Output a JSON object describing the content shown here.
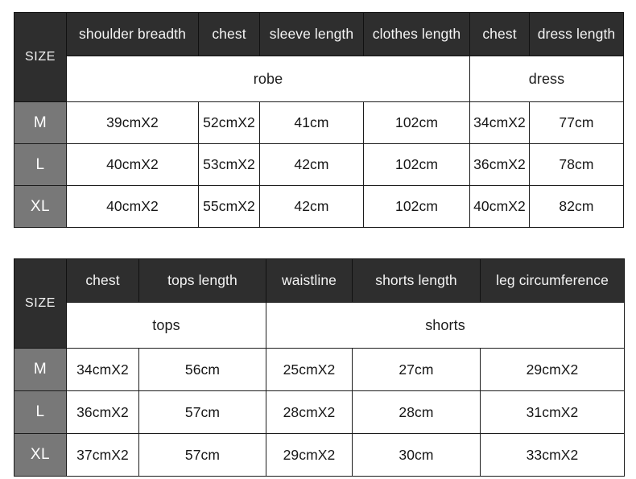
{
  "tables": [
    {
      "id": "robe-dress",
      "size_header": "SIZE",
      "columns": [
        "shoulder breadth",
        "chest",
        "sleeve length",
        "clothes length",
        "chest",
        "dress length"
      ],
      "groups": [
        {
          "label": "robe",
          "span": 4
        },
        {
          "label": "dress",
          "span": 2
        }
      ],
      "rows": [
        {
          "size": "M",
          "values": [
            "39cmX2",
            "52cmX2",
            "41cm",
            "102cm",
            "34cmX2",
            "77cm"
          ]
        },
        {
          "size": "L",
          "values": [
            "40cmX2",
            "53cmX2",
            "42cm",
            "102cm",
            "36cmX2",
            "78cm"
          ]
        },
        {
          "size": "XL",
          "values": [
            "40cmX2",
            "55cmX2",
            "42cm",
            "102cm",
            "40cmX2",
            "82cm"
          ]
        }
      ]
    },
    {
      "id": "tops-shorts",
      "size_header": "SIZE",
      "columns": [
        "chest",
        "tops length",
        "waistline",
        "shorts length",
        "leg circumference"
      ],
      "groups": [
        {
          "label": "tops",
          "span": 2
        },
        {
          "label": "shorts",
          "span": 3
        }
      ],
      "rows": [
        {
          "size": "M",
          "values": [
            "34cmX2",
            "56cm",
            "25cmX2",
            "27cm",
            "29cmX2"
          ]
        },
        {
          "size": "L",
          "values": [
            "36cmX2",
            "57cm",
            "28cmX2",
            "28cm",
            "31cmX2"
          ]
        },
        {
          "size": "XL",
          "values": [
            "37cmX2",
            "57cm",
            "29cmX2",
            "30cm",
            "33cmX2"
          ]
        }
      ]
    }
  ],
  "colors": {
    "header_dark": "#2e2e2e",
    "size_cell_gray": "#787878",
    "cell_background": "#ffffff",
    "border": "#1c1c1c",
    "header_text": "#f4f4f4",
    "body_text": "#161616"
  }
}
